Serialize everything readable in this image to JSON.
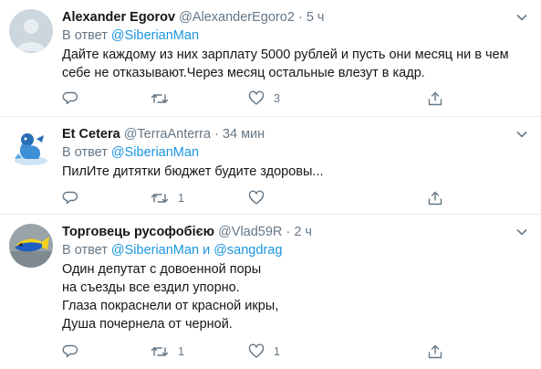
{
  "tweets": [
    {
      "name": "Alexander Egorov",
      "handle": "@AlexanderEgoro2",
      "separator": "·",
      "time": "5 ч",
      "reply_prefix": "В ответ",
      "mention1": "@SiberianMan",
      "text_lines": [
        "Дайте каждому из них зарплату 5000 рублей и пусть они месяц ни в чем",
        "себе не отказывают.Через месяц остальные влезут в кадр."
      ],
      "reply_count": "",
      "retweet_count": "",
      "like_count": "3",
      "avatar_icon": "default-user-avatar"
    },
    {
      "name": "Et Cetera",
      "handle": "@TerraAnterra",
      "separator": "·",
      "time": "34 мин",
      "reply_prefix": "В ответ",
      "mention1": "@SiberianMan",
      "text_lines": [
        "ПилИте дитятки бюджет будите здоровы..."
      ],
      "reply_count": "",
      "retweet_count": "1",
      "like_count": "",
      "avatar_icon": "blue-figure-avatar"
    },
    {
      "name": "Торговець русофобією",
      "handle": "@Vlad59R",
      "separator": "·",
      "time": "2 ч",
      "reply_prefix": "В ответ",
      "mention1": "@SiberianMan",
      "conjunction": "и",
      "mention2": "@sangdrag",
      "text_lines": [
        "Один депутат с довоенной поры",
        "на съезды все ездил упорно.",
        "Глаза покраснели от красной икры,",
        "Душа почернела от черной."
      ],
      "reply_count": "",
      "retweet_count": "1",
      "like_count": "1",
      "avatar_icon": "blue-yellow-fish-avatar"
    }
  ],
  "colors": {
    "accent": "#1b95e0",
    "muted": "#657786",
    "text": "#14171a",
    "divider": "#e6ecf0"
  },
  "icons": [
    "chevron-down-icon",
    "reply-icon",
    "retweet-icon",
    "like-icon",
    "share-icon"
  ]
}
